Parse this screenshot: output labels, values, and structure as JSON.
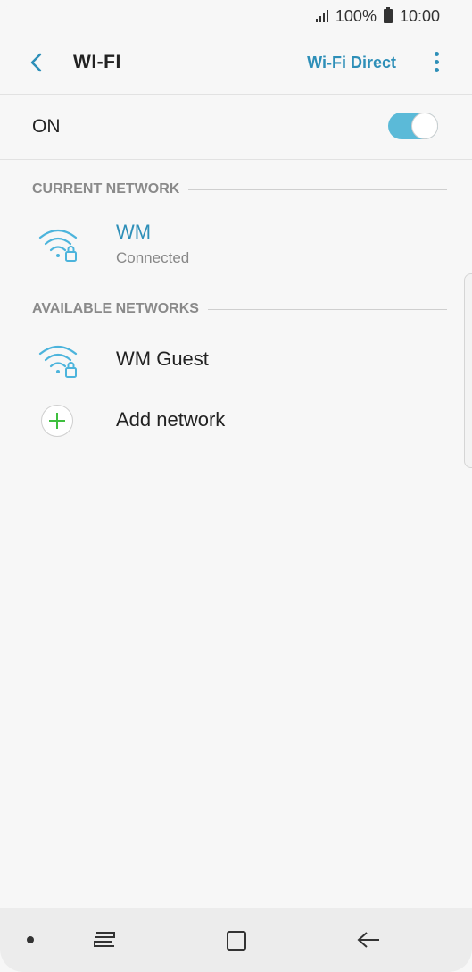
{
  "status": {
    "battery": "100%",
    "time": "10:00",
    "icons": [
      "signal-icon",
      "battery-icon"
    ]
  },
  "header": {
    "title": "WI-FI",
    "wifi_direct": "Wi-Fi Direct",
    "icons": [
      "back-arrow-icon",
      "more-options-icon"
    ]
  },
  "toggle": {
    "label": "ON",
    "state": "on",
    "accent_color": "#5bbad8"
  },
  "current": {
    "section_title": "CURRENT NETWORK",
    "network": {
      "name": "WM",
      "status": "Connected",
      "icon": "wifi-locked-icon"
    }
  },
  "available": {
    "section_title": "AVAILABLE NETWORKS",
    "networks": [
      {
        "name": "WM Guest",
        "icon": "wifi-locked-icon"
      }
    ],
    "add_label": "Add network",
    "add_icon": "add-circle-icon"
  },
  "navbar": {
    "icons": [
      "nav-dot-icon",
      "recent-apps-icon",
      "home-icon",
      "back-icon"
    ]
  },
  "colors": {
    "accent": "#2e8fb8",
    "wifi_icon": "#4cb4dc",
    "add_plus": "#3fbf3f"
  }
}
